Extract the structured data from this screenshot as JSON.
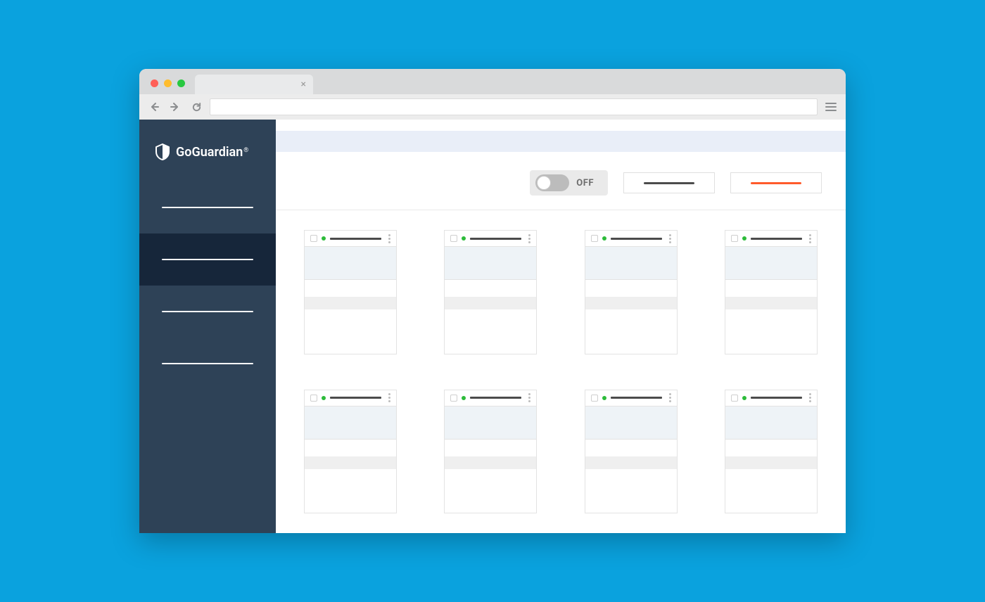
{
  "browser": {
    "tab_close_glyph": "×"
  },
  "brand": {
    "name": "GoGuardian",
    "registered": "®"
  },
  "sidebar": {
    "items": [
      {
        "active": false
      },
      {
        "active": true
      },
      {
        "active": false
      },
      {
        "active": false
      }
    ]
  },
  "controls": {
    "toggle": {
      "state": "off",
      "label": "OFF"
    },
    "button_a": {
      "color": "dark"
    },
    "button_b": {
      "color": "orange"
    }
  },
  "cards": [
    {
      "status": "online"
    },
    {
      "status": "online"
    },
    {
      "status": "online"
    },
    {
      "status": "online"
    },
    {
      "status": "online"
    },
    {
      "status": "online"
    },
    {
      "status": "online"
    },
    {
      "status": "online"
    }
  ],
  "colors": {
    "page_bg": "#0aa2de",
    "sidebar_bg": "#2e4257",
    "sidebar_active_bg": "#16263a",
    "accent_orange": "#ff5a2b",
    "status_green": "#2dbb3a"
  }
}
